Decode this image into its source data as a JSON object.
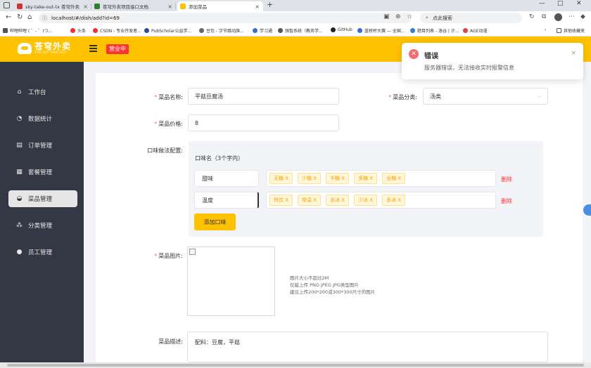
{
  "browser": {
    "tabs": [
      {
        "title": "sky-take-out-tx 苍穹外卖",
        "active": false
      },
      {
        "title": "苍穹外卖项目接口文档",
        "active": false
      },
      {
        "title": "添加菜品",
        "active": true
      }
    ],
    "new_tab": "+",
    "window_controls": [
      "—",
      "□",
      "✕"
    ],
    "url": "localhost/#/dish/add?id=69",
    "search_placeholder": "点此搜索",
    "bookmarks": [
      "哔哩哔哩 ( ゜- ゜)つ...",
      "头条",
      "CSDN - 专业开发者...",
      "PubScholar公益学...",
      "豆包 - 字节跳动旗...",
      "学习通",
      "强智系统（教务学...",
      "GitHub",
      "蓝桥杯大赛 — 全国...",
      "题目列表 - 洛谷 | 计...",
      "AGE动漫",
      "其他收藏夹"
    ]
  },
  "header": {
    "logo_text": "苍穹外卖",
    "logo_sub": "THE SKY TAKE-OUT",
    "status": "营业中"
  },
  "sidebar": {
    "items": [
      {
        "label": "工作台",
        "icon": "home-icon",
        "active": false
      },
      {
        "label": "数据统计",
        "icon": "chart-icon",
        "active": false
      },
      {
        "label": "订单管理",
        "icon": "order-icon",
        "active": false
      },
      {
        "label": "套餐管理",
        "icon": "package-icon",
        "active": false
      },
      {
        "label": "菜品管理",
        "icon": "dish-icon",
        "active": true
      },
      {
        "label": "分类管理",
        "icon": "category-icon",
        "active": false
      },
      {
        "label": "员工管理",
        "icon": "employee-icon",
        "active": false
      }
    ]
  },
  "form": {
    "name_label": "菜品名称:",
    "name_value": "平菇豆腐汤",
    "category_label": "菜品分类:",
    "category_value": "汤类",
    "price_label": "菜品价格:",
    "price_value": "8",
    "flavor_label": "口味做法配置:",
    "flavor_head": "口味名（3个字内）",
    "flavors": [
      {
        "name": "甜味",
        "tags": [
          "无糖 X",
          "少糖 X",
          "半糖 X",
          "多糖 X",
          "全糖 X"
        ],
        "delete": "删除"
      },
      {
        "name": "温度",
        "tags": [
          "热饮 X",
          "常温 X",
          "去冰 X",
          "少冰 X",
          "多冰 X"
        ],
        "delete": "删除"
      }
    ],
    "add_flavor": "添加口味",
    "image_label": "菜品图片:",
    "image_hints": [
      "图片大小不超过2M",
      "仅能上传 PNG JPEG JPG类型图片",
      "建议上传200*200或300*300尺寸的图片"
    ],
    "desc_label": "菜品描述:",
    "desc_value": "配料：豆腐，平菇"
  },
  "notification": {
    "title": "错误",
    "message": "服务器错误，无法接收实时报警信息",
    "close": "×"
  }
}
